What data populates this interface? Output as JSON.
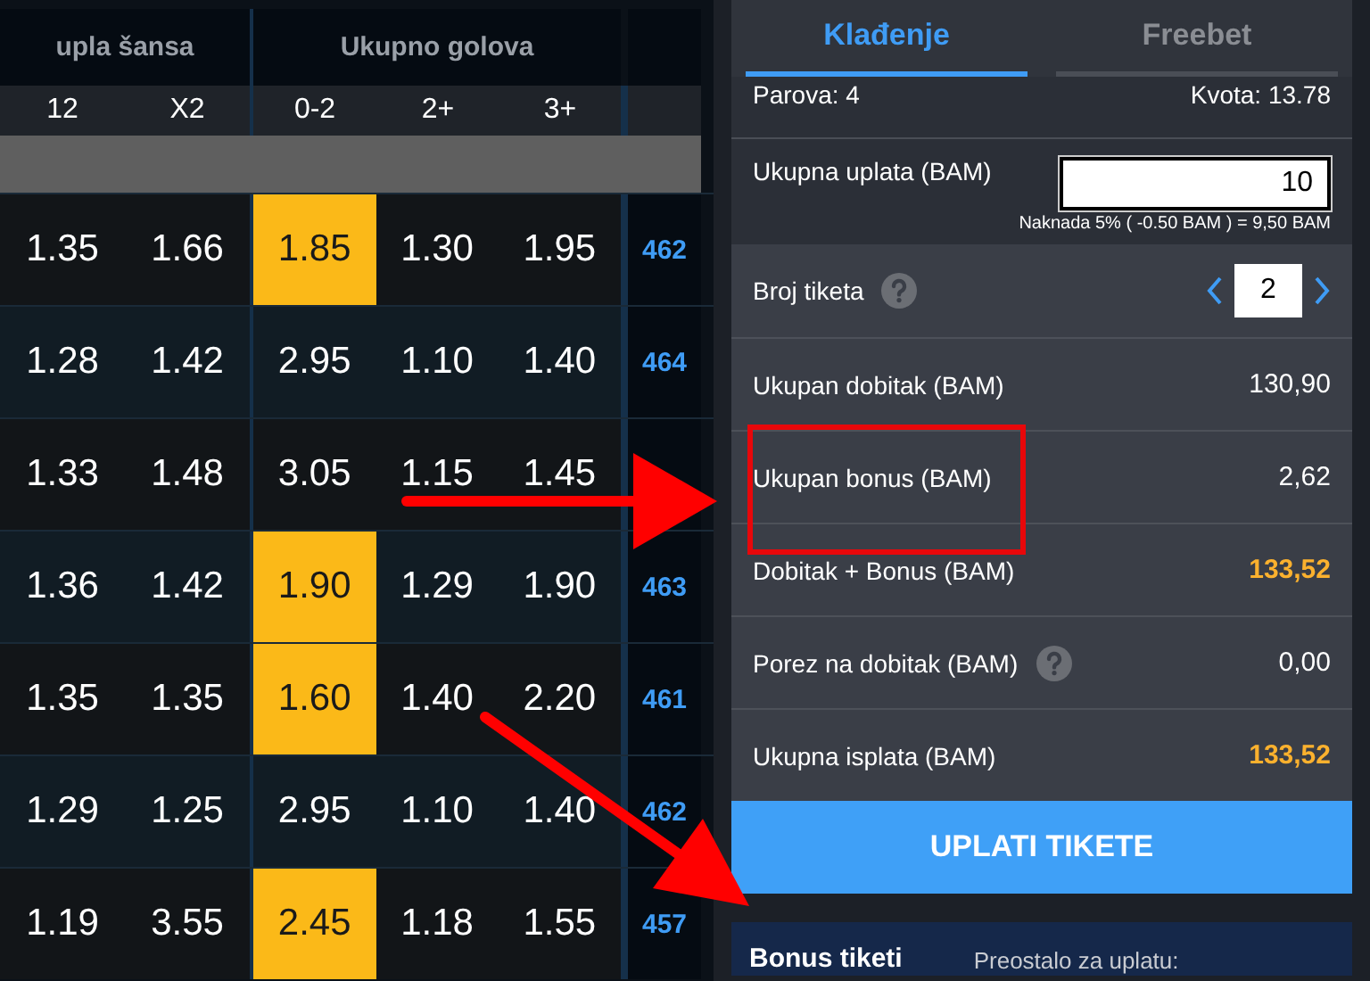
{
  "market_groups": [
    {
      "title": "upla šansa"
    },
    {
      "title": "Ukupno golova"
    }
  ],
  "columns": [
    "12",
    "X2",
    "0-2",
    "2+",
    "3+"
  ],
  "rows": [
    {
      "odds": [
        {
          "value": "1.35",
          "selected": false
        },
        {
          "value": "1.66",
          "selected": false
        },
        {
          "value": "1.85",
          "selected": true
        },
        {
          "value": "1.30",
          "selected": false
        },
        {
          "value": "1.95",
          "selected": false
        }
      ],
      "code": "462"
    },
    {
      "odds": [
        {
          "value": "1.28",
          "selected": false
        },
        {
          "value": "1.42",
          "selected": false
        },
        {
          "value": "2.95",
          "selected": false
        },
        {
          "value": "1.10",
          "selected": false
        },
        {
          "value": "1.40",
          "selected": false
        }
      ],
      "code": "464"
    },
    {
      "odds": [
        {
          "value": "1.33",
          "selected": false
        },
        {
          "value": "1.48",
          "selected": false
        },
        {
          "value": "3.05",
          "selected": false
        },
        {
          "value": "1.15",
          "selected": false
        },
        {
          "value": "1.45",
          "selected": false
        }
      ]
    },
    {
      "odds": [
        {
          "value": "1.36",
          "selected": false
        },
        {
          "value": "1.42",
          "selected": false
        },
        {
          "value": "1.90",
          "selected": true
        },
        {
          "value": "1.29",
          "selected": false
        },
        {
          "value": "1.90",
          "selected": false
        }
      ],
      "code": "463"
    },
    {
      "odds": [
        {
          "value": "1.35",
          "selected": false
        },
        {
          "value": "1.35",
          "selected": false
        },
        {
          "value": "1.60",
          "selected": true
        },
        {
          "value": "1.40",
          "selected": false
        },
        {
          "value": "2.20",
          "selected": false
        }
      ],
      "code": "461"
    },
    {
      "odds": [
        {
          "value": "1.29",
          "selected": false
        },
        {
          "value": "1.25",
          "selected": false
        },
        {
          "value": "2.95",
          "selected": false
        },
        {
          "value": "1.10",
          "selected": false
        },
        {
          "value": "1.40",
          "selected": false
        }
      ],
      "code": "462"
    },
    {
      "odds": [
        {
          "value": "1.19",
          "selected": false
        },
        {
          "value": "3.55",
          "selected": false
        },
        {
          "value": "2.45",
          "selected": true
        },
        {
          "value": "1.18",
          "selected": false
        },
        {
          "value": "1.55",
          "selected": false
        }
      ],
      "code": "457"
    }
  ],
  "slip": {
    "tabs": [
      {
        "label": "Klađenje",
        "selected": true
      },
      {
        "label": "Freebet",
        "selected": false
      }
    ],
    "pairs": "Parova: 4",
    "odds_total": "Kvota: 13.78",
    "stake": {
      "label": "Ukupna uplata (BAM)",
      "value": "10",
      "note": "Naknada 5% ( -0.50 BAM ) = 9,50 BAM"
    },
    "tickets": {
      "label": "Broj tiketa",
      "value": "2",
      "help": true
    },
    "lines": [
      {
        "label": "Ukupan dobitak (BAM)",
        "value": "130,90",
        "highlight": false,
        "help": false,
        "outlined": false
      },
      {
        "label": "Ukupan bonus (BAM)",
        "value": "2,62",
        "highlight": false,
        "help": false,
        "outlined": true
      },
      {
        "label": "Dobitak + Bonus (BAM)",
        "value": "133,52",
        "highlight": true,
        "help": false,
        "outlined": false
      },
      {
        "label": "Porez na dobitak (BAM)",
        "value": "0,00",
        "highlight": false,
        "help": true,
        "outlined": false
      },
      {
        "label": "Ukupna isplata (BAM)",
        "value": "133,52",
        "highlight": true,
        "help": false,
        "outlined": false
      }
    ],
    "button": "UPLATI TIKETE"
  },
  "bonus_strip": {
    "title": "Bonus tiketi",
    "text": "Preostalo za uplatu:"
  }
}
